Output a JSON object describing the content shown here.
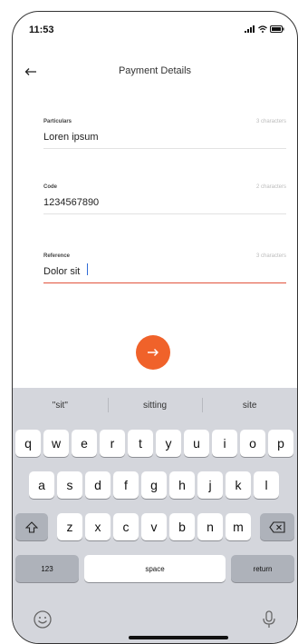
{
  "status_bar": {
    "time": "11:53",
    "icons": [
      "signal-icon",
      "wifi-icon",
      "battery-icon"
    ]
  },
  "header": {
    "back_icon": "back-arrow-icon",
    "title": "Payment Details"
  },
  "fields": [
    {
      "label": "Particulars",
      "counter": "3 characters",
      "value": "Loren ipsum",
      "active": false
    },
    {
      "label": "Code",
      "counter": "2 characters",
      "value": "1234567890",
      "active": false
    },
    {
      "label": "Reference",
      "counter": "3 characters",
      "value": "Dolor sit",
      "active": true
    }
  ],
  "next_button": {
    "icon": "arrow-right-icon",
    "color": "#f0622a"
  },
  "keyboard": {
    "suggestions": [
      "\"sit\"",
      "sitting",
      "site"
    ],
    "row1": [
      "q",
      "w",
      "e",
      "r",
      "t",
      "y",
      "u",
      "i",
      "o",
      "p"
    ],
    "row2": [
      "a",
      "s",
      "d",
      "f",
      "g",
      "h",
      "j",
      "k",
      "l"
    ],
    "row3": [
      "z",
      "x",
      "c",
      "v",
      "b",
      "n",
      "m"
    ],
    "shift_icon": "shift-icon",
    "delete_icon": "delete-icon",
    "numbers_label": "123",
    "space_label": "space",
    "return_label": "return",
    "emoji_icon": "emoji-icon",
    "mic_icon": "microphone-icon"
  },
  "colors": {
    "accent": "#f0622a",
    "active_underline": "#e2533d",
    "keyboard_bg": "#d4d6dc"
  }
}
